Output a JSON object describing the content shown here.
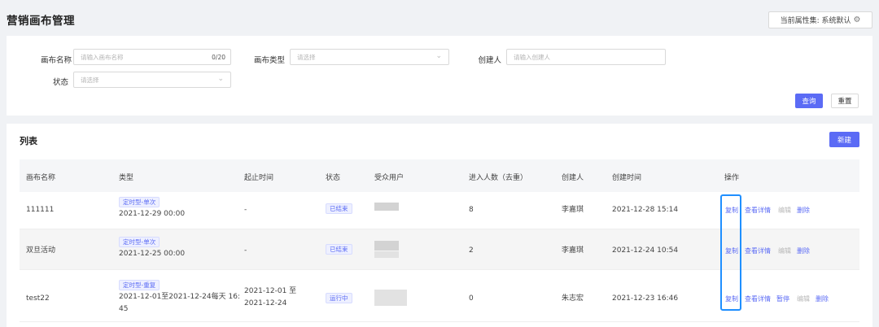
{
  "header": {
    "title": "营销画布管理",
    "attr_set_label": "当前属性集: 系统默认"
  },
  "filters": {
    "canvas_name_label": "画布名称",
    "canvas_name_placeholder": "请输入画布名称",
    "canvas_name_count": "0/20",
    "canvas_type_label": "画布类型",
    "canvas_type_placeholder": "请选择",
    "creator_label": "创建人",
    "creator_placeholder": "请输入创建人",
    "status_label": "状态",
    "status_placeholder": "请选择",
    "query_label": "查询",
    "reset_label": "重置"
  },
  "list": {
    "title": "列表",
    "new_label": "新建",
    "columns": [
      "画布名称",
      "类型",
      "起止时间",
      "状态",
      "受众用户",
      "进入人数（去重）",
      "创建人",
      "创建时间",
      "操作"
    ],
    "rows": [
      {
        "name": "111111",
        "type_tag": "定时型-单次",
        "type_time_1": "2021-12-29 00:00",
        "type_time_2": "",
        "range_1": "-",
        "range_2": "",
        "status": "已结束",
        "count": "8",
        "creator": "李嘉琪",
        "created": "2021-12-28 15:14",
        "ops": [
          "复制",
          "查看详情",
          "编辑",
          "删除"
        ]
      },
      {
        "name": "双旦活动",
        "type_tag": "定时型-单次",
        "type_time_1": "2021-12-25 00:00",
        "type_time_2": "",
        "range_1": "-",
        "range_2": "",
        "status": "已结束",
        "count": "2",
        "creator": "李嘉琪",
        "created": "2021-12-24 10:54",
        "ops": [
          "复制",
          "查看详情",
          "编辑",
          "删除"
        ]
      },
      {
        "name": "test22",
        "type_tag": "定时型-重复",
        "type_time_1": "2021-12-01至2021-12-24每天 16:",
        "type_time_2": "45",
        "range_1": "2021-12-01 至",
        "range_2": "2021-12-24",
        "status": "运行中",
        "count": "0",
        "creator": "朱志宏",
        "created": "2021-12-23 16:46",
        "ops": [
          "复制",
          "查看详情",
          "暂停",
          "编辑",
          "删除"
        ]
      }
    ]
  }
}
